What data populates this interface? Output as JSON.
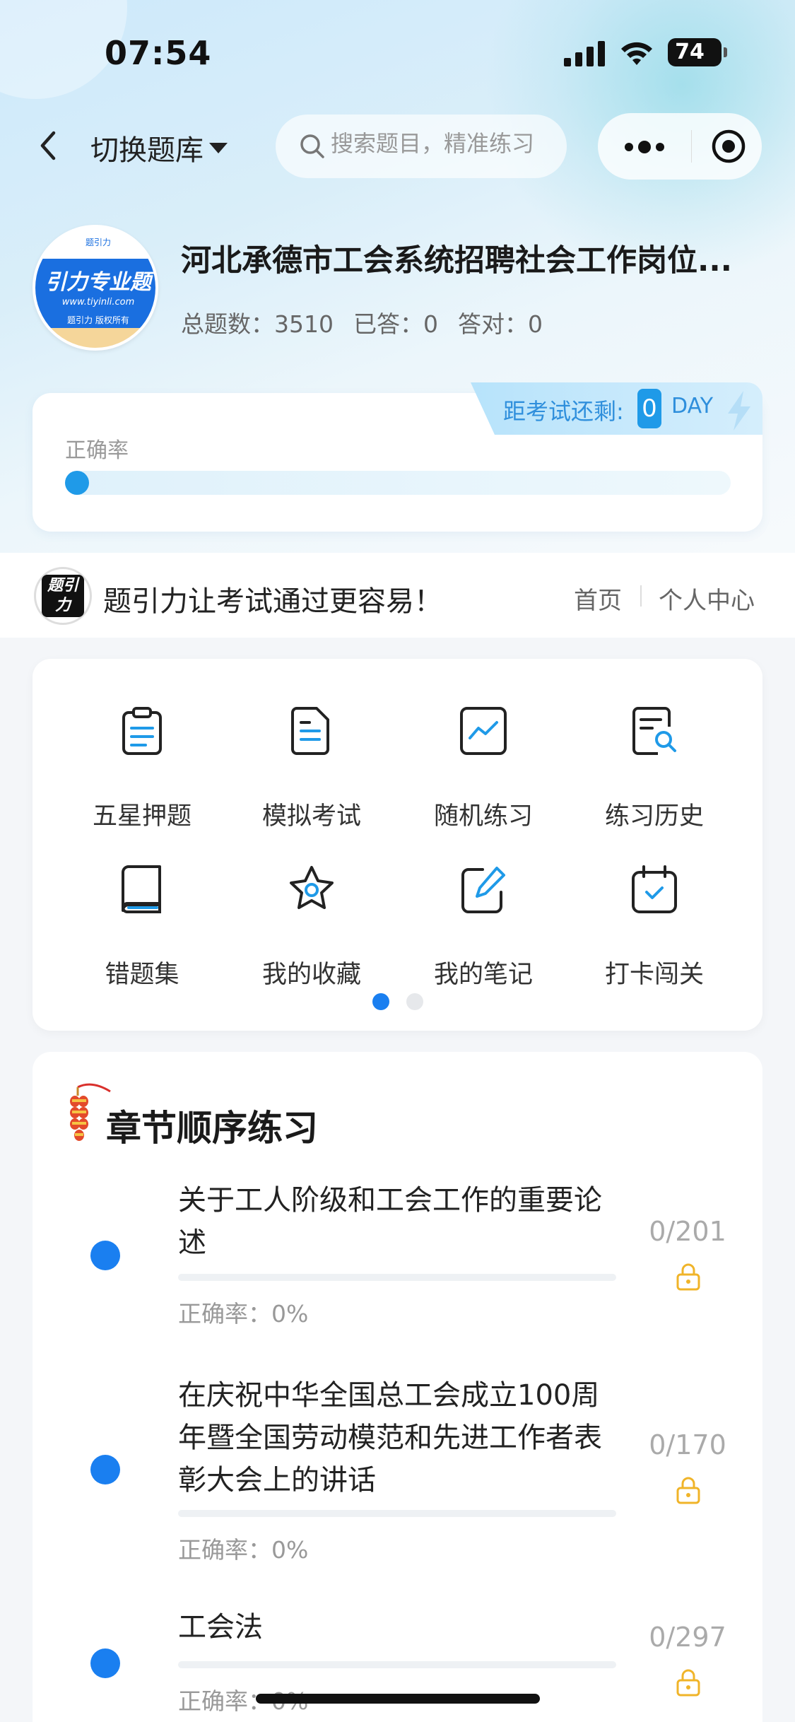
{
  "status_bar": {
    "time": "07:54",
    "battery": "74"
  },
  "nav": {
    "switch_label": "切换题库",
    "search_placeholder": "搜索题目，精准练习"
  },
  "bank": {
    "title": "河北承德市工会系统招聘社会工作岗位...",
    "logo": {
      "brand": "引力专业题",
      "site": "www.tiyinli.com",
      "copyright": "题引力 版权所有",
      "top": "题引力"
    },
    "stats": [
      "总题数：3510",
      "已答：0",
      "答对：0"
    ]
  },
  "accuracy": {
    "label": "正确率",
    "value_percent": 0,
    "countdown_label": "距考试还剩:",
    "countdown_value": "0",
    "countdown_unit": "DAY"
  },
  "slogan": {
    "logo_text": "题引力",
    "text": "题引力让考试通过更容易！",
    "home": "首页",
    "profile": "个人中心"
  },
  "features": [
    {
      "label": "五星押题",
      "icon": "clipboard-icon"
    },
    {
      "label": "模拟考试",
      "icon": "document-icon"
    },
    {
      "label": "随机练习",
      "icon": "chart-icon"
    },
    {
      "label": "练习历史",
      "icon": "document-search-icon"
    },
    {
      "label": "错题集",
      "icon": "book-icon"
    },
    {
      "label": "我的收藏",
      "icon": "star-icon"
    },
    {
      "label": "我的笔记",
      "icon": "pencil-note-icon"
    },
    {
      "label": "打卡闯关",
      "icon": "calendar-check-icon"
    }
  ],
  "pager": {
    "active": 0,
    "count": 2
  },
  "chapter": {
    "title": "章节顺序练习",
    "items": [
      {
        "name": "关于工人阶级和工会工作的重要论述",
        "accuracy": "正确率：0%",
        "count": "0/201"
      },
      {
        "name": "在庆祝中华全国总工会成立100周年暨全国劳动模范和先进工作者表彰大会上的讲话",
        "accuracy": "正确率：0%",
        "count": "0/170"
      },
      {
        "name": "工会法",
        "accuracy": "正确率：0%",
        "count": "0/297"
      }
    ]
  },
  "colors": {
    "accent": "#1a7ff0",
    "progress": "#1f9ae8",
    "lock": "#f0b429"
  }
}
